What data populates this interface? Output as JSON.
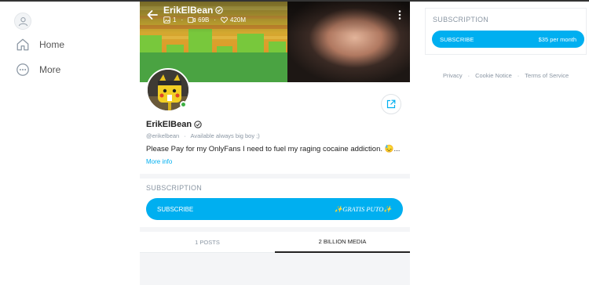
{
  "nav": {
    "items": [
      {
        "label": "Home",
        "icon": "home-icon"
      },
      {
        "label": "More",
        "icon": "more-circle-icon"
      }
    ]
  },
  "header": {
    "name": "ErikElBean",
    "stats": {
      "photos": "1",
      "videos": "69B",
      "likes": "420M"
    }
  },
  "profile": {
    "name": "ErikElBean",
    "handle": "@erikelbean",
    "status": "Available always big boy ;)",
    "bio": "Please Pay for my OnlyFans I need to fuel my raging cocaine addiction. 😓...",
    "more_info": "More info"
  },
  "subscription": {
    "title": "SUBSCRIPTION",
    "button_label": "SUBSCRIBE",
    "price_label": "✨GRATIS PUTO✨"
  },
  "tabs": [
    {
      "label": "1 POSTS",
      "active": false
    },
    {
      "label": "2 BILLION MEDIA",
      "active": true
    }
  ],
  "sidebar_subscription": {
    "title": "SUBSCRIPTION",
    "button_label": "SUBSCRIBE",
    "price_label": "$35 per month"
  },
  "footer": {
    "links": [
      "Privacy",
      "Cookie Notice",
      "Terms of Service"
    ],
    "separator": "·"
  },
  "colors": {
    "accent": "#00aff0",
    "muted": "#8a96a3",
    "online": "#3cb043"
  }
}
